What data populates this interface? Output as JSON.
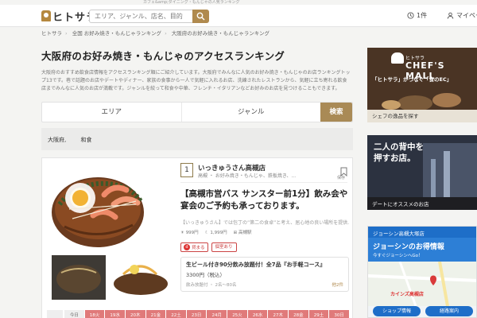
{
  "top_strip": "カフェ&amp;ダイニング・もんじゃの人気ランキング",
  "header": {
    "logo_text": "ヒトサラ",
    "search_placeholder": "エリア、ジャンル、店名、目的",
    "ticket_count": "1件",
    "mypage_label": "マイペー"
  },
  "breadcrumb": [
    "ヒトサラ",
    "全国 お好み焼き・もんじゃランキング",
    "大阪府のお好み焼き・もんじゃランキング"
  ],
  "main": {
    "title": "大阪府のお好み焼き・もんじゃのアクセスランキング",
    "intro": "大阪府のおすすめ飲食店情報をアクセスランキング順にご紹介しています。大阪府でみんなに人気のお好み焼き・もんじゃのお店ランキングトップ13です。巷で話題のお店やデートやディナー、家族の食事から一人で気軽に入れるお店、洗練されたレストランから、気軽に立ち寄れる飲食店までみんなに人気のお店が満載です。ジャンルを絞って和食や中華、フレンチ・イタリアンなどお好みのお店を見つけることもできます。"
  },
  "filter": {
    "area_label": "エリア",
    "genre_label": "ジャンル",
    "search_button": "検索"
  },
  "chips": [
    "大阪府,",
    "和食"
  ],
  "card": {
    "rank": "1",
    "shop_name": "いっきゅうさん高槻店",
    "shop_sub": "高槻 ・ お好み焼き・もんじゃ、鉄板焼き、...",
    "save_label": "保存",
    "headline": "【高槻市営バス サンスター前1分】飲み会や宴会のご予約も承っております。",
    "desc": "【いっきゅうさん】では包丁の”第二の食卓”と考え、居心地の良い場所を提供...",
    "price_lunch": "999円",
    "price_dinner": "1,999円",
    "station": "高槻駅",
    "tag_reserve": "貸まる",
    "tag_private": "個室あり",
    "course_title": "生ビール付き90分飲み放題付！全7品『お手軽コース』",
    "course_price": "3300円（税込）",
    "course_meta": "飲み放題付 ・ 2名〜80名",
    "course_more": "他2件",
    "dates": [
      "今日",
      "18火",
      "19水",
      "20木",
      "21金",
      "22土",
      "23日",
      "24月",
      "25火",
      "26水",
      "27木",
      "28金",
      "29土",
      "30日"
    ]
  },
  "side": {
    "ad1_title": "CHEF'S MALL",
    "ad1_caption": "シェフの逸品を探す",
    "ad1_sub": "「ヒトサラ」がつなぐ「食のEC」",
    "ad2_title": "二人の背中を押すお店。",
    "ad2_caption": "デートにオススメのお店",
    "ad3_head": "ジョーシン高槻大塚店",
    "ad3_title": "ジョーシンのお得情報",
    "ad3_sub": "今すぐジョーシンへGo！",
    "ad3_map": "カインズ高槻店",
    "ad3_btn1": "ショップ情報",
    "ad3_btn2": "経路案内"
  },
  "colors": {
    "accent": "#b08a4e",
    "date_red": "#e07a7a",
    "tag_red": "#cc4444"
  }
}
